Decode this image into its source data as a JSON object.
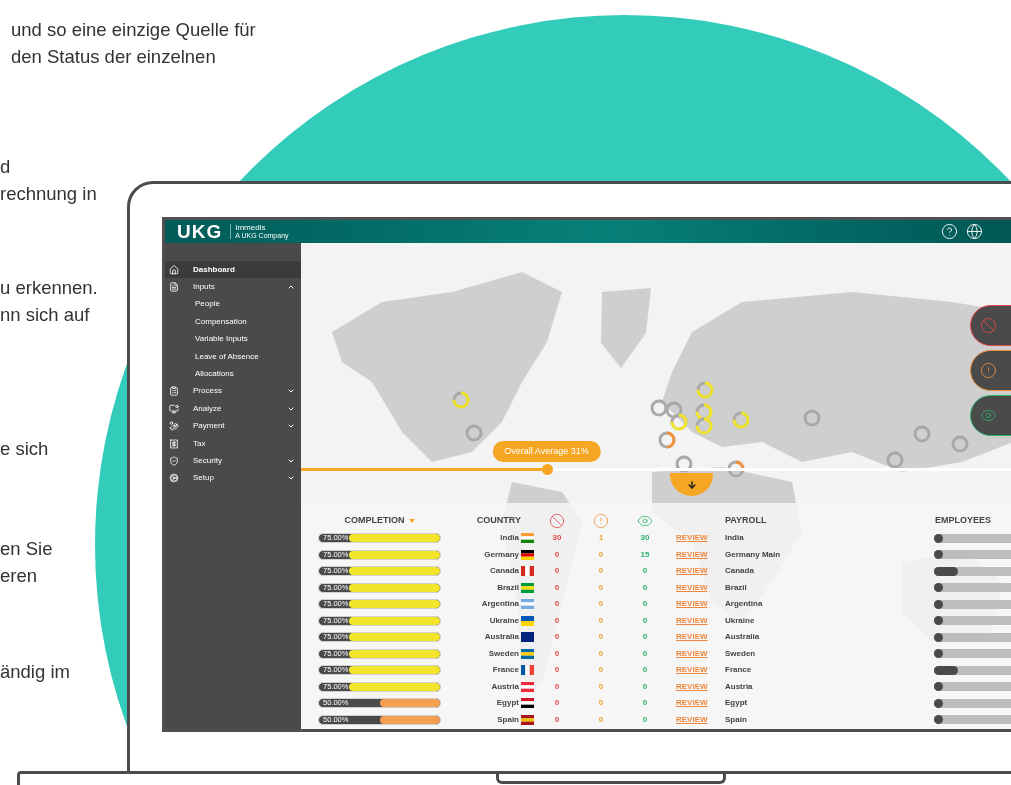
{
  "intro_text": [
    {
      "lines": [
        "und so eine einzige Quelle für",
        "den Status der einzelnen"
      ]
    },
    {
      "lines": [
        "d",
        "rechnung in"
      ]
    },
    {
      "lines": [
        "u erkennen.",
        "nn sich auf"
      ]
    },
    {
      "lines": [
        "e sich"
      ]
    },
    {
      "lines": [
        "en Sie",
        "eren"
      ]
    },
    {
      "lines": [
        "ändig im"
      ]
    }
  ],
  "app": {
    "brand": {
      "logo": "UKG",
      "name": "Immedis",
      "tagline": "A UKG Company"
    },
    "sidebar": {
      "items": [
        {
          "label": "Dashboard",
          "kind": "link",
          "selected": true
        },
        {
          "label": "Inputs",
          "kind": "group",
          "selected": false,
          "expanded": true,
          "children": [
            {
              "label": "People",
              "selected": false
            },
            {
              "label": "Compensation",
              "selected": false
            },
            {
              "label": "Variable Inputs",
              "selected": false
            },
            {
              "label": "Leave of Absence",
              "selected": false
            },
            {
              "label": "Allocations",
              "selected": false
            }
          ]
        },
        {
          "label": "Process",
          "kind": "group",
          "selected": false,
          "expanded": false
        },
        {
          "label": "Analyze",
          "kind": "group",
          "selected": false,
          "expanded": false
        },
        {
          "label": "Payment",
          "kind": "group",
          "selected": false,
          "expanded": false
        },
        {
          "label": "Tax",
          "kind": "link",
          "selected": false
        },
        {
          "label": "Security",
          "kind": "group",
          "selected": false,
          "expanded": false
        },
        {
          "label": "Setup",
          "kind": "group",
          "selected": false,
          "expanded": false
        }
      ]
    },
    "average": {
      "label": "Overall Average 31%",
      "level": 0.33
    },
    "table": {
      "columns": [
        {
          "label": "COMPLETION",
          "sorted": true
        },
        {
          "label": "COUNTRY",
          "sorted": false
        },
        {
          "label": "PAYROLL",
          "sorted": false
        },
        {
          "label": "EMPLOYEES",
          "sorted": false
        }
      ],
      "rows": [
        {
          "completion": {
            "text": "75.00%",
            "level": 0.75
          },
          "country": "India",
          "errors": "30",
          "warnings": "1",
          "reviewed": "30",
          "action": "REVIEW",
          "payroll": "India",
          "employees": {
            "level": 0.02
          }
        },
        {
          "completion": {
            "text": "75.00%",
            "level": 0.75
          },
          "country": "Germany",
          "errors": "0",
          "warnings": "0",
          "reviewed": "15",
          "action": "REVIEW",
          "payroll": "Germany Main",
          "employees": {
            "level": 0.02
          }
        },
        {
          "completion": {
            "text": "75.00%",
            "level": 0.75
          },
          "country": "Canada",
          "errors": "0",
          "warnings": "0",
          "reviewed": "0",
          "action": "REVIEW",
          "payroll": "Canada",
          "employees": {
            "level": 0.2
          }
        },
        {
          "completion": {
            "text": "75.00%",
            "level": 0.75
          },
          "country": "Brazil",
          "errors": "0",
          "warnings": "0",
          "reviewed": "0",
          "action": "REVIEW",
          "payroll": "Brazil",
          "employees": {
            "level": 0.02
          }
        },
        {
          "completion": {
            "text": "75.00%",
            "level": 0.75
          },
          "country": "Argentina",
          "errors": "0",
          "warnings": "0",
          "reviewed": "0",
          "action": "REVIEW",
          "payroll": "Argentina",
          "employees": {
            "level": 0.02
          }
        },
        {
          "completion": {
            "text": "75.00%",
            "level": 0.75
          },
          "country": "Ukraine",
          "errors": "0",
          "warnings": "0",
          "reviewed": "0",
          "action": "REVIEW",
          "payroll": "Ukraine",
          "employees": {
            "level": 0.02
          }
        },
        {
          "completion": {
            "text": "75.00%",
            "level": 0.75
          },
          "country": "Australia",
          "errors": "0",
          "warnings": "0",
          "reviewed": "0",
          "action": "REVIEW",
          "payroll": "Australia",
          "employees": {
            "level": 0.02
          }
        },
        {
          "completion": {
            "text": "75.00%",
            "level": 0.75
          },
          "country": "Sweden",
          "errors": "0",
          "warnings": "0",
          "reviewed": "0",
          "action": "REVIEW",
          "payroll": "Sweden",
          "employees": {
            "level": 0.02
          }
        },
        {
          "completion": {
            "text": "75.00%",
            "level": 0.75
          },
          "country": "France",
          "errors": "0",
          "warnings": "0",
          "reviewed": "0",
          "action": "REVIEW",
          "payroll": "France",
          "employees": {
            "level": 0.2
          }
        },
        {
          "completion": {
            "text": "75.00%",
            "level": 0.75
          },
          "country": "Austria",
          "errors": "0",
          "warnings": "0",
          "reviewed": "0",
          "action": "REVIEW",
          "payroll": "Austria",
          "employees": {
            "level": 0.02
          }
        },
        {
          "completion": {
            "text": "50.00%",
            "level": 0.5
          },
          "country": "Egypt",
          "errors": "0",
          "warnings": "0",
          "reviewed": "0",
          "action": "REVIEW",
          "payroll": "Egypt",
          "employees": {
            "level": 0.02
          }
        },
        {
          "completion": {
            "text": "50.00%",
            "level": 0.5
          },
          "country": "Spain",
          "errors": "0",
          "warnings": "0",
          "reviewed": "0",
          "action": "REVIEW",
          "payroll": "Spain",
          "employees": {
            "level": 0.02
          }
        }
      ]
    }
  }
}
